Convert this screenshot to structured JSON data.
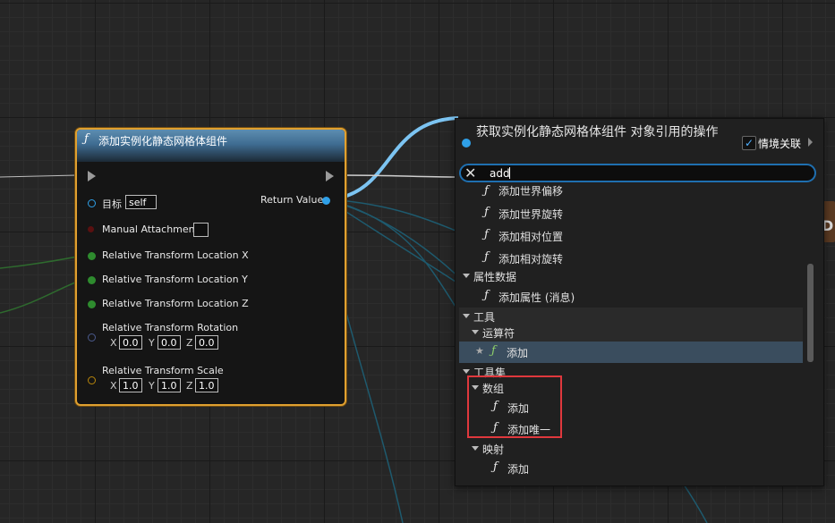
{
  "node": {
    "title": "添加实例化静态网格体组件",
    "pins": {
      "target_label": "目标",
      "target_value": "self",
      "return_label": "Return Value",
      "manual_attachment": "Manual Attachment",
      "loc_x": "Relative Transform Location X",
      "loc_y": "Relative Transform Location Y",
      "loc_z": "Relative Transform Location Z",
      "rotation": "Relative Transform Rotation",
      "rot_x": "0.0",
      "rot_y": "0.0",
      "rot_z": "0.0",
      "scale": "Relative Transform Scale",
      "scale_x": "1.0",
      "scale_y": "1.0",
      "scale_z": "1.0",
      "axis_x": "X",
      "axis_y": "Y",
      "axis_z": "Z"
    }
  },
  "menu": {
    "context_title": "获取实例化静态网格体组件 对象引用的操作",
    "context_checkbox_label": "情境关联",
    "context_checked": true,
    "search_value": "add",
    "items": [
      {
        "label": "添加世界偏移"
      },
      {
        "label": "添加世界旋转"
      },
      {
        "label": "添加相对位置"
      },
      {
        "label": "添加相对旋转"
      },
      {
        "category": "属性数据"
      },
      {
        "label": "添加属性 (消息)"
      },
      {
        "category": "工具"
      },
      {
        "category": "运算符"
      },
      {
        "label": "添加",
        "selected": true
      },
      {
        "category": "工具集"
      },
      {
        "category": "数组"
      },
      {
        "label": "添加"
      },
      {
        "label": "添加唯一"
      },
      {
        "category": "映射"
      },
      {
        "label": "添加"
      }
    ]
  },
  "side_tab_text": "D",
  "colors": {
    "node_border": "#e0a030",
    "object_pin": "#2fa0e8",
    "float_pin": "#2e8b2e",
    "highlight_annotation": "#e0383d",
    "search_border": "#1f6fb0"
  }
}
